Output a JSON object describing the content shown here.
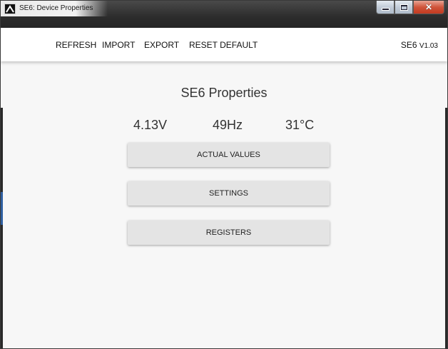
{
  "window": {
    "title": "SE6: Device Properties"
  },
  "menu": {
    "refresh": "REFRESH",
    "import": "IMPORT",
    "export": "EXPORT",
    "reset_default": "RESET DEFAULT"
  },
  "version": {
    "device": "SE6",
    "number": "V1.03"
  },
  "main": {
    "title": "SE6 Properties",
    "readings": {
      "voltage": "4.13V",
      "frequency": "49Hz",
      "temperature": "31°C"
    },
    "buttons": {
      "actual_values": "ACTUAL VALUES",
      "settings": "SETTINGS",
      "registers": "REGISTERS"
    }
  },
  "icons": {
    "app": "app-logo-icon",
    "minimize": "minimize-icon",
    "maximize": "maximize-icon",
    "close": "close-icon"
  },
  "colors": {
    "titlebar": "#2c2c2c",
    "background": "#f7f7f7",
    "button": "#e4e4e4",
    "close_button": "#c2391f"
  }
}
